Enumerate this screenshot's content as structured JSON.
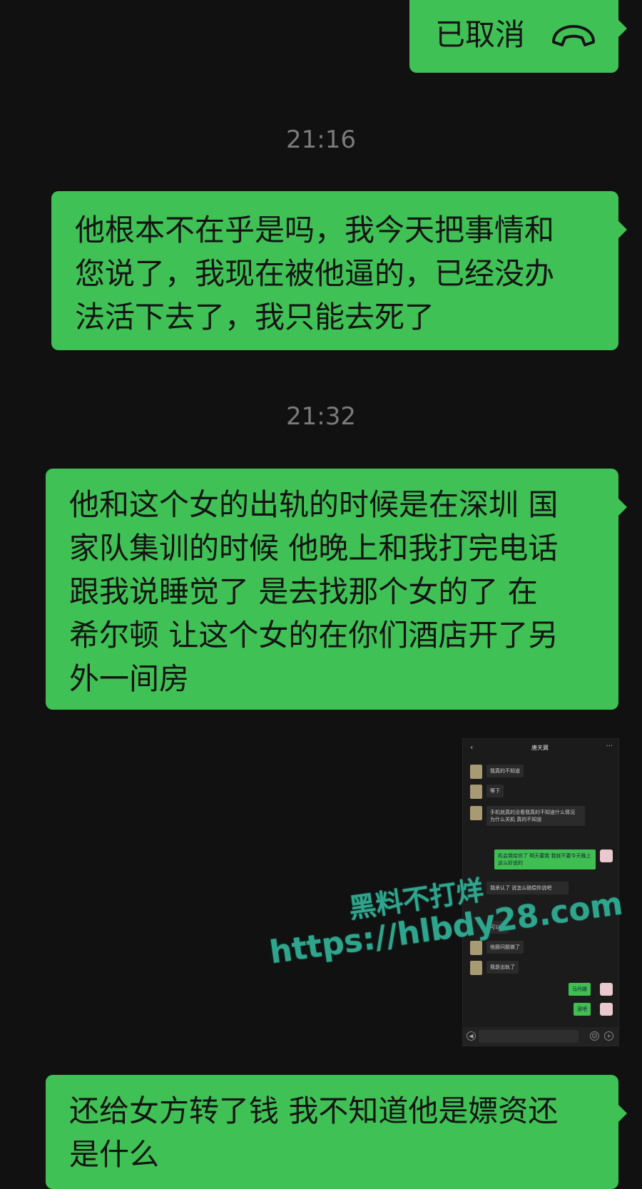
{
  "messages": [
    {
      "text": "已取消"
    },
    {
      "lines": [
        "他根本不在乎是吗，我今天把事情和",
        "您说了，我现在被他逼的，已经没办",
        "法活下去了，我只能去死了"
      ]
    },
    {
      "lines": [
        "他和这个女的出轨的时候是在深圳 国",
        "家队集训的时候 他晚上和我打完电话",
        "跟我说睡觉了 是去找那个女的了 在",
        "希尔顿 让这个女的在你们酒店开了另",
        "外一间房"
      ]
    },
    {
      "lines": [
        "还给女方转了钱 我不知道他是嫖资还",
        "是什么"
      ]
    }
  ],
  "timestamps": [
    "21:16",
    "21:32"
  ],
  "icons": {
    "call_ended": "hangup-phone-icon"
  },
  "screenshot": {
    "title": "唐天翼",
    "back": "‹",
    "more": "···",
    "left_messages": [
      "我真的不知道",
      "等下",
      "手机就真的没看我真的不知道什么情况 为什么关机 真的不知道"
    ],
    "right_message": "机会我给你了 明天要我 我就不要今天晚上这么好说的",
    "left_messages_2": [
      "我承认了 说怎么赔偿你说吧",
      "可以吗",
      "他那问题做了",
      "我是出轨了"
    ],
    "right_short": [
      "马丹娜",
      "滚吧"
    ]
  },
  "watermark": {
    "line1": "黑料不打烊",
    "line2": "https://hlbdy28.com"
  },
  "colors": {
    "bubble": "#3fc155",
    "background": "#111111",
    "timestamp": "#7b7b7b",
    "watermark": "#2fa58d"
  }
}
